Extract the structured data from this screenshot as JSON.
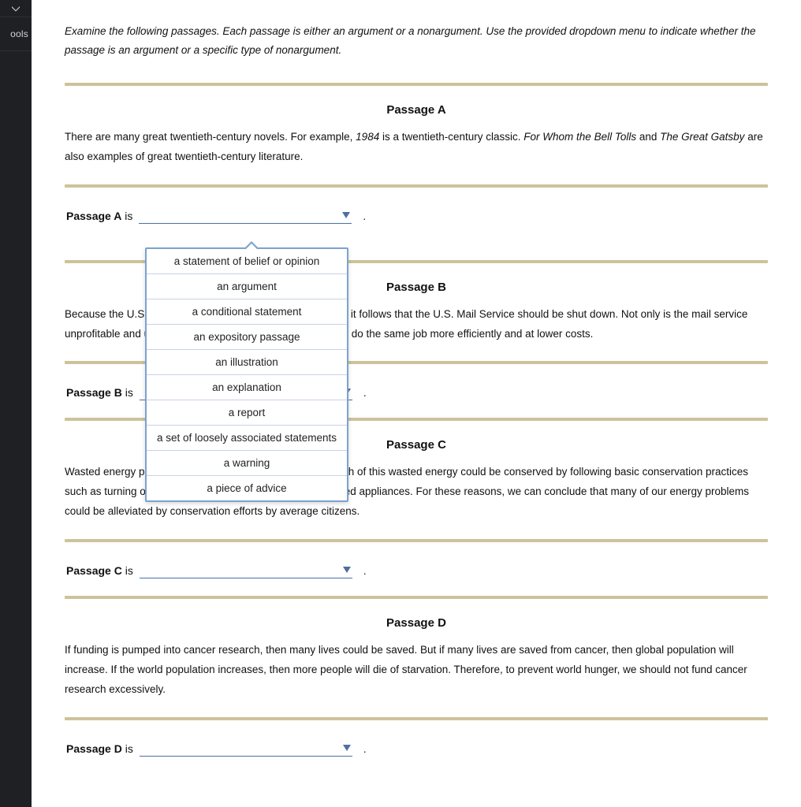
{
  "sidebar": {
    "tab_label": "ools"
  },
  "instructions": "Examine the following passages. Each passage is either an argument or a nonargument. Use the provided dropdown menu to indicate whether the passage is an argument or a specific type of nonargument.",
  "dropdown_options": [
    "a statement of belief or opinion",
    "an argument",
    "a conditional statement",
    "an expository passage",
    "an illustration",
    "an explanation",
    "a report",
    "a set of loosely associated statements",
    "a warning",
    "a piece of advice"
  ],
  "passages": {
    "A": {
      "title": "Passage A",
      "text_pre": "There are many great twentieth-century novels. For example, ",
      "italic1": "1984",
      "text_mid1": " is a twentieth-century classic. ",
      "italic2": "For Whom the Bell Tolls",
      "text_mid2": " and ",
      "italic3": "The Great Gatsby",
      "text_post": " are also examples of great twentieth-century literature.",
      "answer_label": "Passage A",
      "answer_is": " is"
    },
    "B": {
      "title": "Passage B",
      "text": "Because the U.S. Mail Service is hardly, if ever, is profitable, it follows that the U.S. Mail Service should be shut down. Not only is the mail service unprofitable and unnecessary, but other shipping companies do the same job more efficiently and at lower costs.",
      "answer_label": "Passage B",
      "answer_is": " is"
    },
    "C": {
      "title": "Passage C",
      "text": "Wasted energy puts an extra burden on our power grid. Much of this wasted energy could be conserved by following basic conservation practices such as turning off unnecessary lights and unplugging unused appliances. For these reasons, we can conclude that many of our energy problems could be alleviated by conservation efforts by average citizens.",
      "answer_label": "Passage C",
      "answer_is": " is"
    },
    "D": {
      "title": "Passage D",
      "text": "If funding is pumped into cancer research, then many lives could be saved. But if many lives are saved from cancer, then global population will increase. If the world population increases, then more people will die of starvation. Therefore, to prevent world hunger, we should not fund cancer research excessively.",
      "answer_label": "Passage D",
      "answer_is": " is"
    }
  },
  "period": "."
}
